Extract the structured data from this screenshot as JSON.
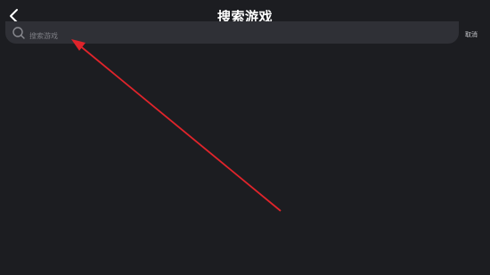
{
  "header": {
    "title": "搜索游戏",
    "back_icon": "chevron-left-icon"
  },
  "search": {
    "placeholder": "搜索游戏",
    "icon": "search-icon"
  },
  "cancel_label": "取消",
  "annotation": {
    "color": "#e0242b"
  }
}
